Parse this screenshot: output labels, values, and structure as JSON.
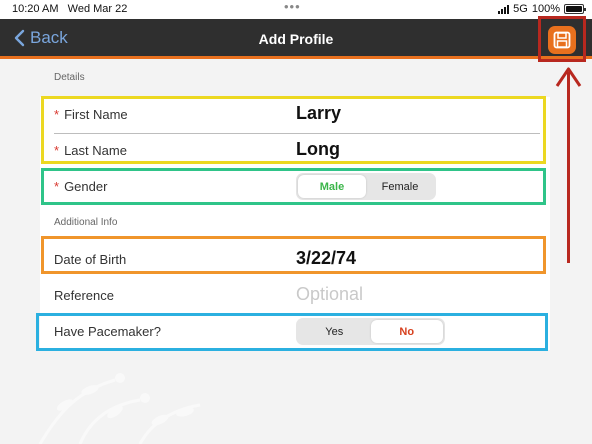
{
  "status_bar": {
    "time": "10:20 AM",
    "date": "Wed Mar 22",
    "network": "5G",
    "battery": "100%",
    "battery_level": 1.0
  },
  "nav": {
    "back_label": "Back",
    "title": "Add Profile",
    "save_icon": "floppy-disk-icon"
  },
  "details": {
    "header": "Details",
    "first_name_label": "First Name",
    "first_name_value": "Larry",
    "last_name_label": "Last Name",
    "last_name_value": "Long",
    "required_marker": "*",
    "gender_label": "Gender",
    "gender_options": [
      "Male",
      "Female"
    ],
    "gender_selected": "Male"
  },
  "additional": {
    "header": "Additional Info",
    "dob_label": "Date of Birth",
    "dob_value": "3/22/74",
    "reference_label": "Reference",
    "reference_placeholder": "Optional",
    "pacemaker_label": "Have Pacemaker?",
    "pacemaker_options": [
      "Yes",
      "No"
    ],
    "pacemaker_selected": "No"
  },
  "colors": {
    "accent": "#e8701e",
    "nav_bg": "#2f2f2f",
    "back_link": "#7aa6dd",
    "male_selected": "#3bb54a",
    "no_selected": "#d7401e",
    "annotation_yellow": "#ecd821",
    "annotation_green": "#2fc489",
    "annotation_orange": "#f0952b",
    "annotation_blue": "#2bb0e0",
    "annotation_red": "#b8281f"
  }
}
